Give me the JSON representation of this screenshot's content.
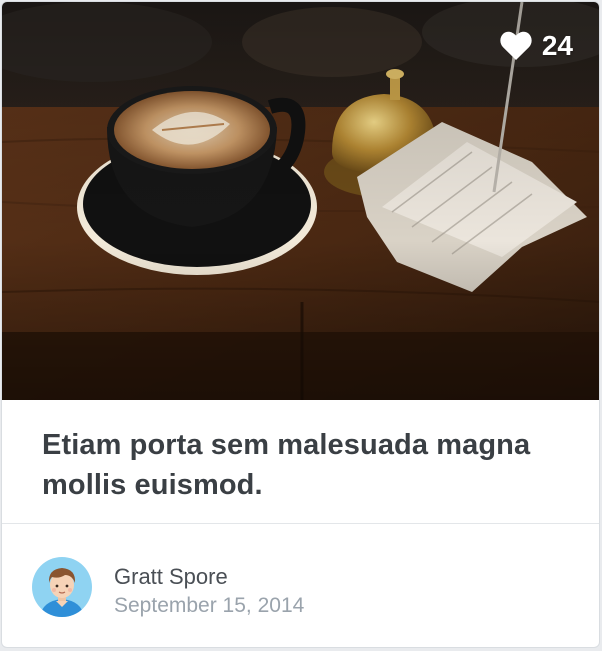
{
  "card": {
    "likes_count": "24",
    "title": "Etiam porta sem malesuada magna mollis euismod.",
    "author": {
      "name": "Gratt Spore",
      "date": "September 15, 2014"
    }
  },
  "icons": {
    "likes": "heart-icon",
    "avatar": "user-avatar"
  },
  "colors": {
    "title": "#3a3f44",
    "author_name": "#4a4f55",
    "author_date": "#9aa3ac",
    "avatar_bg": "#8fd3f2"
  }
}
